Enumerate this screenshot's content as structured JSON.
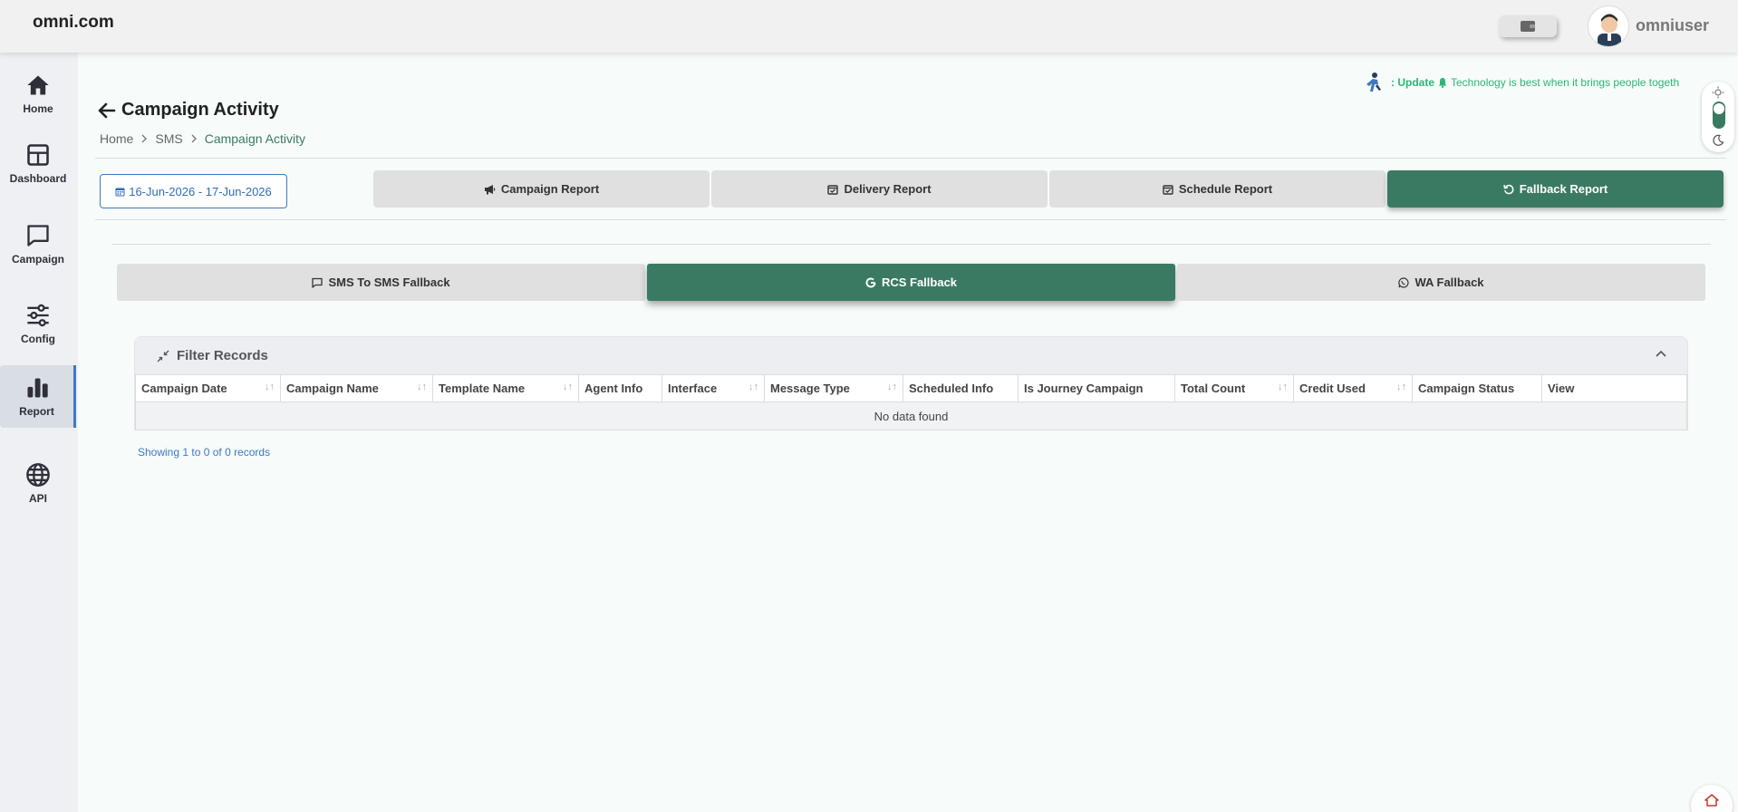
{
  "brand": "omni.com",
  "user": {
    "name": "omniuser"
  },
  "sidebar": {
    "items": [
      {
        "label": "Home",
        "icon": "home-icon"
      },
      {
        "label": "Dashboard",
        "icon": "dashboard-icon"
      },
      {
        "label": "Campaign",
        "icon": "chat-icon"
      },
      {
        "label": "Config",
        "icon": "sliders-icon"
      },
      {
        "label": "Report",
        "icon": "bar-chart-icon",
        "active": true
      },
      {
        "label": "API",
        "icon": "globe-icon"
      }
    ]
  },
  "ticker": {
    "update_label": ": Update",
    "message": "Technology is best when it brings people togeth"
  },
  "page": {
    "title": "Campaign Activity"
  },
  "breadcrumb": [
    "Home",
    "SMS",
    "Campaign Activity"
  ],
  "date_range": "16-Jun-2026 - 17-Jun-2026",
  "report_tabs": [
    {
      "label": "Campaign Report",
      "icon": "megaphone-icon"
    },
    {
      "label": "Delivery Report",
      "icon": "calendar-check-icon"
    },
    {
      "label": "Schedule Report",
      "icon": "calendar-check-icon"
    },
    {
      "label": "Fallback Report",
      "icon": "refresh-icon",
      "active": true
    }
  ],
  "sub_tabs": [
    {
      "label": "SMS To SMS Fallback",
      "icon": "message-icon"
    },
    {
      "label": "RCS Fallback",
      "icon": "google-icon",
      "active": true
    },
    {
      "label": "WA Fallback",
      "icon": "whatsapp-icon"
    }
  ],
  "filter": {
    "title": "Filter Records"
  },
  "table": {
    "columns": [
      {
        "label": "Campaign Date",
        "sortable": true
      },
      {
        "label": "Campaign Name",
        "sortable": true
      },
      {
        "label": "Template Name",
        "sortable": true
      },
      {
        "label": "Agent Info",
        "sortable": false
      },
      {
        "label": "Interface",
        "sortable": true
      },
      {
        "label": "Message Type",
        "sortable": true
      },
      {
        "label": "Scheduled Info",
        "sortable": false
      },
      {
        "label": "Is Journey Campaign",
        "sortable": false
      },
      {
        "label": "Total Count",
        "sortable": true
      },
      {
        "label": "Credit Used",
        "sortable": true
      },
      {
        "label": "Campaign Status",
        "sortable": false
      },
      {
        "label": "View",
        "sortable": false
      }
    ],
    "empty_message": "No data found"
  },
  "records_info": "Showing 1 to 0 of 0 records",
  "colors": {
    "accent": "#3a7a63",
    "link": "#3d79c2",
    "ticker": "#2bb673"
  }
}
